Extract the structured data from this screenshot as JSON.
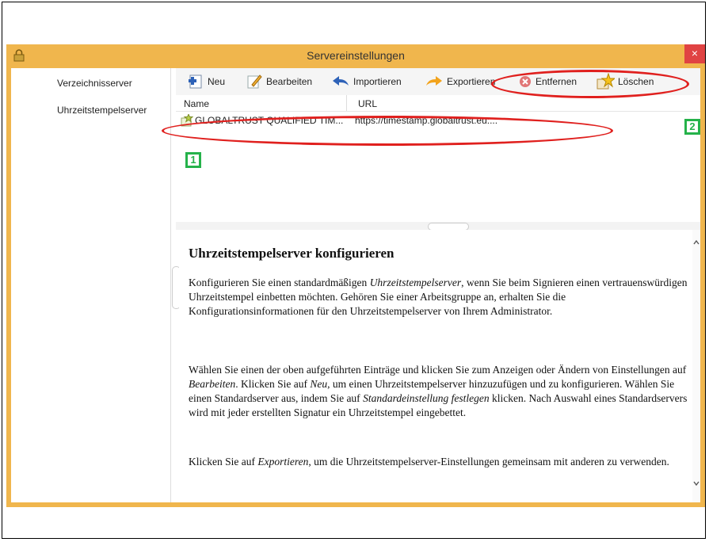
{
  "window": {
    "title": "Servereinstellungen",
    "close_label": "×"
  },
  "sidebar": {
    "items": [
      {
        "label": "Verzeichnisserver"
      },
      {
        "label": "Uhrzeitstempelserver"
      }
    ]
  },
  "toolbar": {
    "new_label": "Neu",
    "edit_label": "Bearbeiten",
    "import_label": "Importieren",
    "export_label": "Exportieren",
    "remove_label": "Entfernen",
    "delete_label": "Löschen"
  },
  "list": {
    "columns": [
      "Name",
      "URL"
    ],
    "rows": [
      {
        "name": "GLOBALTRUST QUALIFIED TIM...",
        "url": "https://timestamp.globaltrust.eu:..."
      }
    ]
  },
  "help": {
    "heading": "Uhrzeitstempelserver konfigurieren",
    "p1_a": "Konfigurieren Sie einen standardmäßigen ",
    "p1_i": "Uhrzeitstempelserver",
    "p1_b": ", wenn Sie beim Signieren einen vertrauenswürdigen Uhrzeitstempel einbetten möchten. Gehören Sie einer Arbeitsgruppe an, erhalten Sie die Konfigurationsinformationen für den Uhrzeitstempelserver von Ihrem Administrator.",
    "p2_a": "Wählen Sie einen der oben aufgeführten Einträge und klicken Sie zum Anzeigen oder Ändern von Einstellungen auf ",
    "p2_i1": "Bearbeiten",
    "p2_b": ". Klicken Sie auf ",
    "p2_i2": "Neu",
    "p2_c": ", um einen Uhrzeitstempelserver hinzuzufügen und zu konfigurieren. Wählen Sie einen Standardserver aus, indem Sie auf ",
    "p2_i3": "Standardeinstellung festlegen",
    "p2_d": " klicken. Nach Auswahl eines Standardservers wird mit jeder erstellten Signatur ein Uhrzeitstempel eingebettet.",
    "p3_a": "Klicken Sie auf ",
    "p3_i": "Exportieren",
    "p3_b": ", um die Uhrzeitstempelserver-Einstellungen gemeinsam mit anderen zu verwenden."
  },
  "annotations": {
    "badge1": "1",
    "badge2": "2"
  },
  "colors": {
    "window_frame": "#f0b64d",
    "close": "#e04343",
    "oval": "#e0201e",
    "badge": "#25b24a"
  }
}
